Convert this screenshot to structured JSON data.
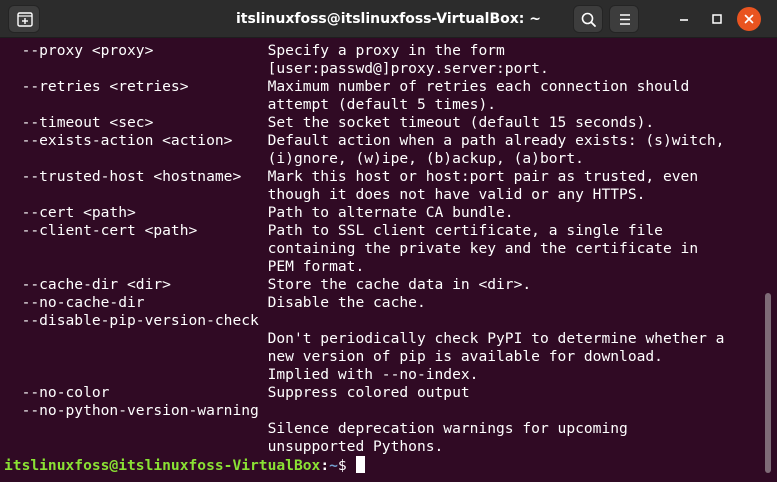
{
  "window": {
    "title": "itslinuxfoss@itslinuxfoss-VirtualBox: ~"
  },
  "terminal": {
    "lines": [
      "  --proxy <proxy>             Specify a proxy in the form",
      "                              [user:passwd@]proxy.server:port.",
      "  --retries <retries>         Maximum number of retries each connection should",
      "                              attempt (default 5 times).",
      "  --timeout <sec>             Set the socket timeout (default 15 seconds).",
      "  --exists-action <action>    Default action when a path already exists: (s)witch,",
      "                              (i)gnore, (w)ipe, (b)ackup, (a)bort.",
      "  --trusted-host <hostname>   Mark this host or host:port pair as trusted, even",
      "                              though it does not have valid or any HTTPS.",
      "  --cert <path>               Path to alternate CA bundle.",
      "  --client-cert <path>        Path to SSL client certificate, a single file",
      "                              containing the private key and the certificate in",
      "                              PEM format.",
      "  --cache-dir <dir>           Store the cache data in <dir>.",
      "  --no-cache-dir              Disable the cache.",
      "  --disable-pip-version-check",
      "                              Don't periodically check PyPI to determine whether a",
      "                              new version of pip is available for download.",
      "                              Implied with --no-index.",
      "  --no-color                  Suppress colored output",
      "  --no-python-version-warning",
      "                              Silence deprecation warnings for upcoming",
      "                              unsupported Pythons."
    ],
    "prompt": {
      "user_host": "itslinuxfoss@itslinuxfoss-VirtualBox",
      "separator": ":",
      "path": "~",
      "symbol": "$"
    }
  },
  "icons": {
    "new_tab": "new-tab-icon",
    "search": "search-icon",
    "menu": "hamburger-menu-icon",
    "minimize": "minimize-icon",
    "maximize": "maximize-icon",
    "close": "close-icon"
  },
  "colors": {
    "terminal_background": "#300a24",
    "titlebar_background": "#2c2c2c",
    "prompt_user": "#8ae234",
    "prompt_path": "#729fcf",
    "close_button": "#e95420"
  }
}
